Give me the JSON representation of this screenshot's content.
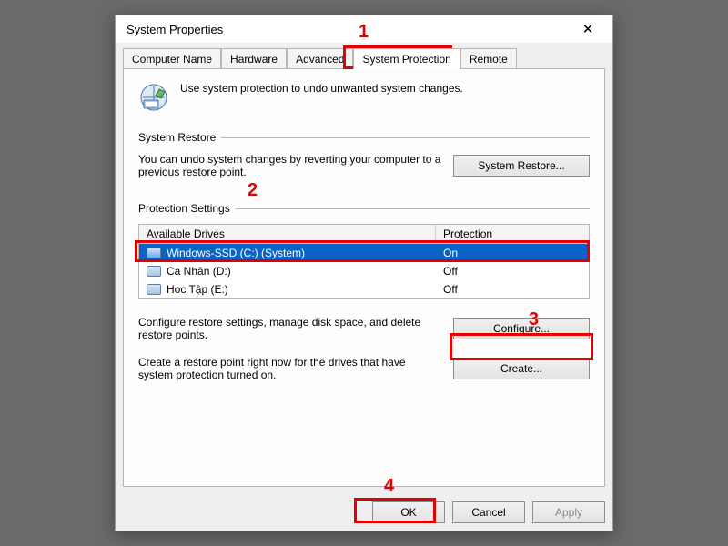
{
  "window": {
    "title": "System Properties"
  },
  "tabs": {
    "computer_name": "Computer Name",
    "hardware": "Hardware",
    "advanced": "Advanced",
    "system_protection": "System Protection",
    "remote": "Remote"
  },
  "intro": "Use system protection to undo unwanted system changes.",
  "groups": {
    "restore": {
      "title": "System Restore",
      "desc": "You can undo system changes by reverting your computer to a previous restore point.",
      "button": "System Restore..."
    },
    "protection": {
      "title": "Protection Settings",
      "cols": {
        "drive": "Available Drives",
        "prot": "Protection"
      },
      "rows": [
        {
          "name": "Windows-SSD (C:) (System)",
          "prot": "On",
          "selected": true,
          "win": true
        },
        {
          "name": "Ca Nhân (D:)",
          "prot": "Off",
          "selected": false,
          "win": false
        },
        {
          "name": "Hoc Tập (E:)",
          "prot": "Off",
          "selected": false,
          "win": false
        }
      ],
      "configure_desc": "Configure restore settings, manage disk space, and delete restore points.",
      "configure_btn": "Configure...",
      "create_desc": "Create a restore point right now for the drives that have system protection turned on.",
      "create_btn": "Create..."
    }
  },
  "footer": {
    "ok": "OK",
    "cancel": "Cancel",
    "apply": "Apply"
  },
  "annotations": {
    "n1": "1",
    "n2": "2",
    "n3": "3",
    "n4": "4"
  }
}
